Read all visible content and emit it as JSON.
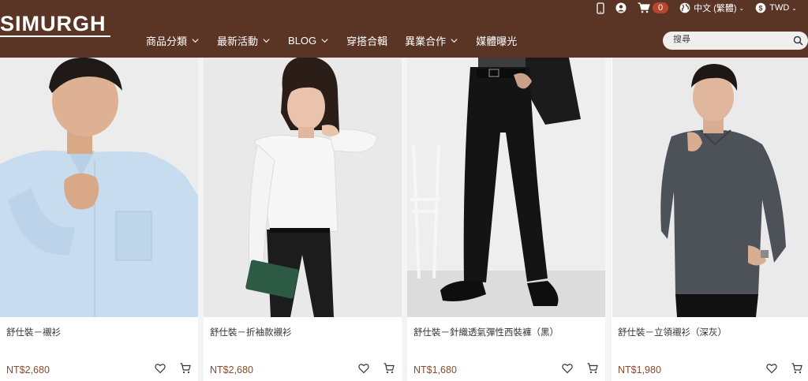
{
  "header": {
    "logo": "SIMURGH",
    "cart_count": "0",
    "language": "中文 (繁體)",
    "currency": "TWD",
    "search_placeholder": "搜尋"
  },
  "nav": [
    {
      "label": "商品分類",
      "dropdown": true
    },
    {
      "label": "最新活動",
      "dropdown": true
    },
    {
      "label": "BLOG",
      "dropdown": true
    },
    {
      "label": "穿搭合輯",
      "dropdown": false
    },
    {
      "label": "異業合作",
      "dropdown": true
    },
    {
      "label": "媒體曝光",
      "dropdown": false
    }
  ],
  "products": [
    {
      "name": "舒仕裝－襯衫",
      "price": "NT$2,680"
    },
    {
      "name": "舒仕裝－折袖款襯衫",
      "price": "NT$2,680"
    },
    {
      "name": "舒仕裝－針織透氣彈性西裝褲（黑）",
      "price": "NT$1,680"
    },
    {
      "name": "舒仕裝－立領襯衫（深灰）",
      "price": "NT$1,980"
    }
  ],
  "colors": {
    "header_bg": "#5a3526",
    "price": "#8a4b2a",
    "badge": "#b4472c"
  }
}
